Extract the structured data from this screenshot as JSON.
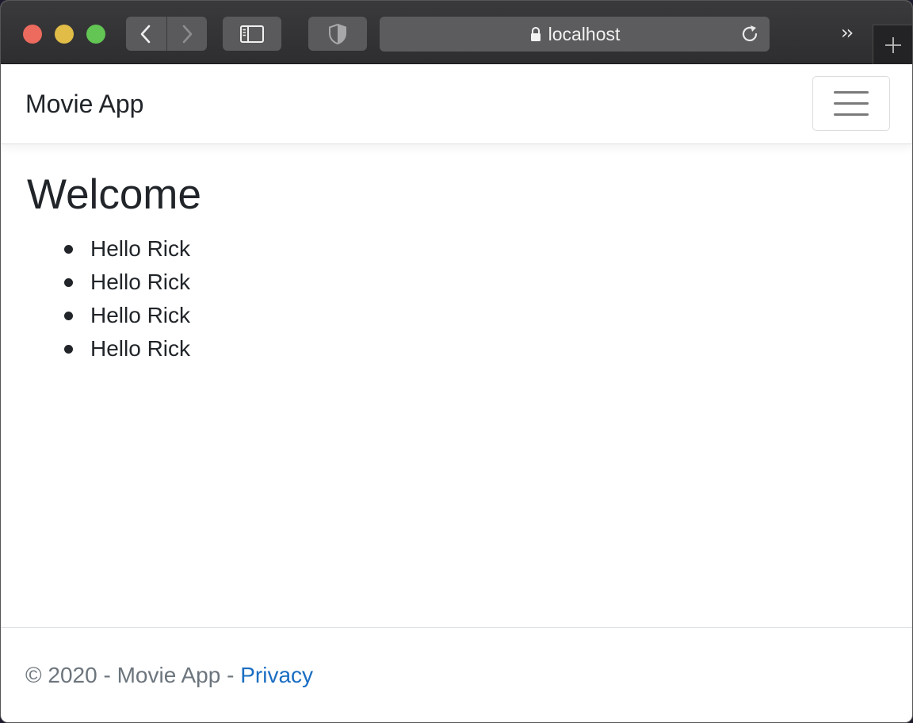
{
  "browser": {
    "address": "localhost",
    "icons": {
      "back": "chevron-left-icon",
      "forward": "chevron-right-icon",
      "sidebar": "sidebar-icon",
      "privacy": "shield-icon",
      "lock": "lock-icon",
      "reload": "reload-icon",
      "more": "double-chevron-icon",
      "new_tab": "plus-icon"
    },
    "more_glyph": "››"
  },
  "navbar": {
    "brand": "Movie App",
    "toggle_icon": "hamburger-menu-icon"
  },
  "main": {
    "title": "Welcome",
    "items": [
      "Hello Rick",
      "Hello Rick",
      "Hello Rick",
      "Hello Rick"
    ]
  },
  "footer": {
    "copyright": "© 2020 - Movie App - ",
    "privacy_link": "Privacy"
  },
  "colors": {
    "link": "#1b6ec2",
    "text": "#212529",
    "muted": "#6c757d"
  }
}
